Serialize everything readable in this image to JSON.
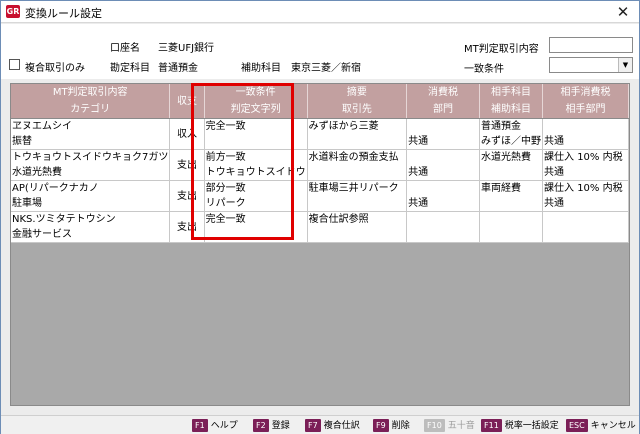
{
  "window": {
    "title": "変換ルール設定",
    "icon_text": "GR",
    "close_glyph": "✕"
  },
  "form": {
    "account_label": "口座名",
    "account_value": "三菱UFJ銀行",
    "subject_label": "勘定科目",
    "subject_value": "普通預金",
    "aux_label": "補助科目",
    "aux_value": "東京三菱／新宿",
    "compound_label": "複合取引のみ",
    "mt_content_label": "MT判定取引内容",
    "mt_content_value": "",
    "match_label": "一致条件",
    "match_value": ""
  },
  "table": {
    "headers": [
      {
        "top": "MT判定取引内容",
        "bottom": "カテゴリ"
      },
      {
        "top": "収支",
        "bottom": ""
      },
      {
        "top": "一致条件",
        "bottom": "判定文字列"
      },
      {
        "top": "摘要",
        "bottom": "取引先"
      },
      {
        "top": "消費税",
        "bottom": "部門"
      },
      {
        "top": "相手科目",
        "bottom": "補助科目"
      },
      {
        "top": "相手消費税",
        "bottom": "相手部門"
      }
    ],
    "rows": [
      {
        "content": "ヱヌエムシイ",
        "category": "振替",
        "type": "収入",
        "match": "完全一致",
        "match_str": "",
        "summary": "みずほから三菱",
        "partner": "",
        "tax": "",
        "dept": "共通",
        "acct": "普通預金",
        "sub_acct": "みずほ／中野",
        "p_tax": "",
        "p_dept": "共通"
      },
      {
        "content": "トウキョウトスイドウキョク7ガツ",
        "category": "水道光熱費",
        "type": "支出",
        "match": "前方一致",
        "match_str": "トウキョウトスイドウ",
        "summary": "水道料金の預金支払",
        "partner": "",
        "tax": "",
        "dept": "共通",
        "acct": "水道光熱費",
        "sub_acct": "",
        "p_tax": "課仕入 10% 内税",
        "p_dept": "共通"
      },
      {
        "content": "AP(リパークナカノ",
        "category": "駐車場",
        "type": "支出",
        "match": "部分一致",
        "match_str": "リパーク",
        "summary": "駐車場三井リパーク",
        "partner": "",
        "tax": "",
        "dept": "共通",
        "acct": "車両経費",
        "sub_acct": "",
        "p_tax": "課仕入 10% 内税",
        "p_dept": "共通"
      },
      {
        "content": "NKS.ツミタテトウシン",
        "category": "金融サービス",
        "type": "支出",
        "match": "完全一致",
        "match_str": "",
        "summary": "複合仕訳参照",
        "partner": "",
        "tax": "",
        "dept": "",
        "acct": "",
        "sub_acct": "",
        "p_tax": "",
        "p_dept": ""
      }
    ]
  },
  "fkeys": [
    {
      "key": "F1",
      "label": "ヘルプ",
      "disabled": false
    },
    {
      "key": "F2",
      "label": "登録",
      "disabled": false
    },
    {
      "key": "F7",
      "label": "複合仕訳",
      "disabled": false
    },
    {
      "key": "F9",
      "label": "削除",
      "disabled": false
    },
    {
      "key": "F10",
      "label": "五十音",
      "disabled": true
    },
    {
      "key": "F11",
      "label": "税率一括設定",
      "disabled": false
    },
    {
      "key": "ESC",
      "label": "キャンセル",
      "disabled": false
    }
  ]
}
